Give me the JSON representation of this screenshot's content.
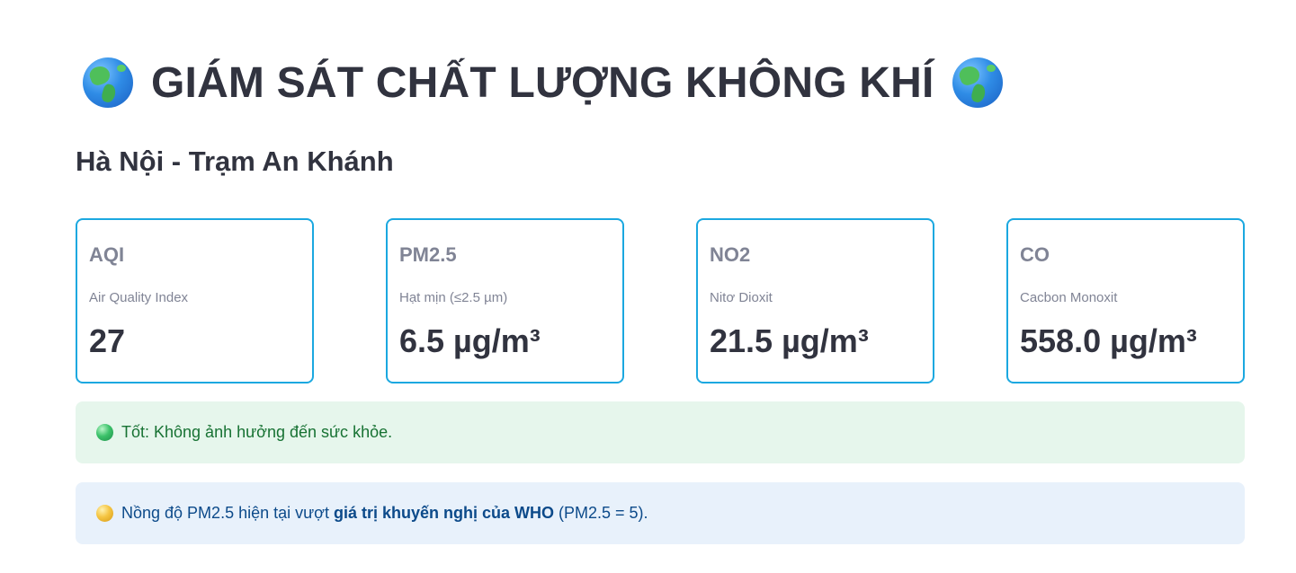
{
  "header": {
    "title": "GIÁM SÁT CHẤT LƯỢNG KHÔNG KHÍ",
    "left_icon": "globe-americas-icon",
    "right_icon": "globe-americas-icon",
    "subtitle": "Hà Nội - Trạm An Khánh"
  },
  "metrics": [
    {
      "label": "AQI",
      "description": "Air Quality Index",
      "value": "27"
    },
    {
      "label": "PM2.5",
      "description": "Hạt mịn (≤2.5 µm)",
      "value": "6.5 µg/m³"
    },
    {
      "label": "NO2",
      "description": "Nitơ Dioxit",
      "value": "21.5 µg/m³"
    },
    {
      "label": "CO",
      "description": "Cacbon Monoxit",
      "value": "558.0 µg/m³"
    }
  ],
  "alerts": {
    "status": {
      "icon": "green-circle-icon",
      "text": "Tốt: Không ảnh hưởng đến sức khỏe."
    },
    "who": {
      "icon": "yellow-circle-icon",
      "prefix": "Nồng độ PM2.5 hiện tại vượt ",
      "emphasis": "giá trị khuyến nghị của WHO",
      "suffix": " (PM2.5 = 5)."
    }
  },
  "colors": {
    "card_border": "#1ba8e0",
    "success_bg": "#e6f6ec",
    "success_text": "#177233",
    "info_bg": "#e8f1fb",
    "info_text": "#0c4a8a",
    "text_primary": "#31333f",
    "text_muted": "#808495"
  }
}
